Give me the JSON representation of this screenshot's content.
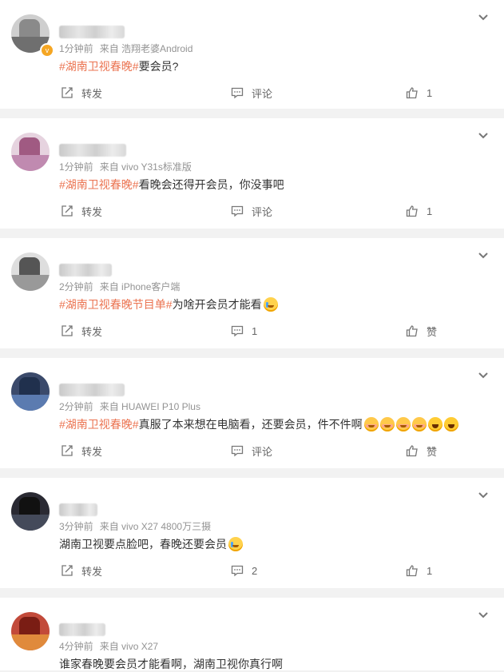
{
  "actions": {
    "repost_label": "转发",
    "comment_label": "评论",
    "like_label": "赞"
  },
  "comments": [
    {
      "time": "1分钟前",
      "source": "来自 浩翔老婆Android",
      "topic": "#湖南卫视春晚#",
      "text": "要会员?",
      "repost": "转发",
      "comment": "评论",
      "like": "1",
      "verified": true
    },
    {
      "time": "1分钟前",
      "source": "来自 vivo Y31s标准版",
      "topic": "#湖南卫视春晚#",
      "text": "看晚会还得开会员，你没事吧",
      "repost": "转发",
      "comment": "评论",
      "like": "1"
    },
    {
      "time": "2分钟前",
      "source": "来自 iPhone客户端",
      "topic": "#湖南卫视春晚节目单#",
      "text": "为啥开会员才能看",
      "emojis": [
        "cry"
      ],
      "repost": "转发",
      "comment": "1",
      "like": "赞"
    },
    {
      "time": "2分钟前",
      "source": "来自 HUAWEI P10 Plus",
      "topic": "#湖南卫视春晚#",
      "text": "真服了本来想在电脑看，还要会员，件不件啊",
      "emojis": [
        "blush",
        "blush",
        "blush",
        "blush",
        "laugh",
        "laugh"
      ],
      "repost": "转发",
      "comment": "评论",
      "like": "赞"
    },
    {
      "time": "3分钟前",
      "source": "来自 vivo X27 4800万三摄",
      "topic": "",
      "text": "湖南卫视要点脸吧，春晚还要会员",
      "emojis": [
        "cry"
      ],
      "repost": "转发",
      "comment": "2",
      "like": "1"
    },
    {
      "time": "4分钟前",
      "source": "来自 vivo X27",
      "topic": "",
      "text": "谁家春晚要会员才能看啊，湖南卫视你真行啊"
    }
  ],
  "icons": {
    "repost": "repost-icon",
    "comment": "comment-icon",
    "like": "thumbs-up-icon",
    "more": "chevron-down-icon"
  },
  "colors": {
    "topic": "#eb7350",
    "meta": "#939393",
    "background": "#f2f2f2"
  }
}
